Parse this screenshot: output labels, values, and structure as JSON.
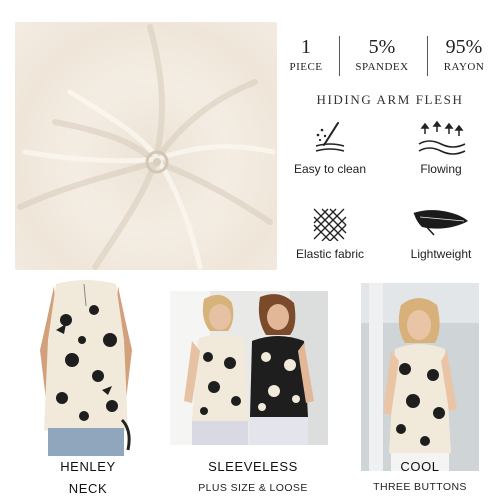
{
  "stats": [
    {
      "number": "1",
      "label": "PIECE"
    },
    {
      "number": "5%",
      "label": "SPANDEX"
    },
    {
      "number": "95%",
      "label": "RAYON"
    }
  ],
  "heading": "HIDING ARM FLESH",
  "features": [
    {
      "label": "Easy to clean",
      "icon": "easy-clean-icon"
    },
    {
      "label": "Flowing",
      "icon": "flowing-icon"
    },
    {
      "label": "Elastic fabric",
      "icon": "elastic-fabric-icon"
    },
    {
      "label": "Lightweight",
      "icon": "feather-icon"
    }
  ],
  "captions": [
    {
      "line1": "HENLEY",
      "line2": "NECK"
    },
    {
      "line1": "SLEEVELESS",
      "line2": "PLUS SIZE & LOOSE"
    },
    {
      "line1": "COOL",
      "line2": "THREE BUTTONS"
    }
  ],
  "colors": {
    "fabric": "#efe6d9",
    "print_light": "#f1eadb",
    "print_dark": "#1e1e1e",
    "denim": "#8fa6bd"
  }
}
